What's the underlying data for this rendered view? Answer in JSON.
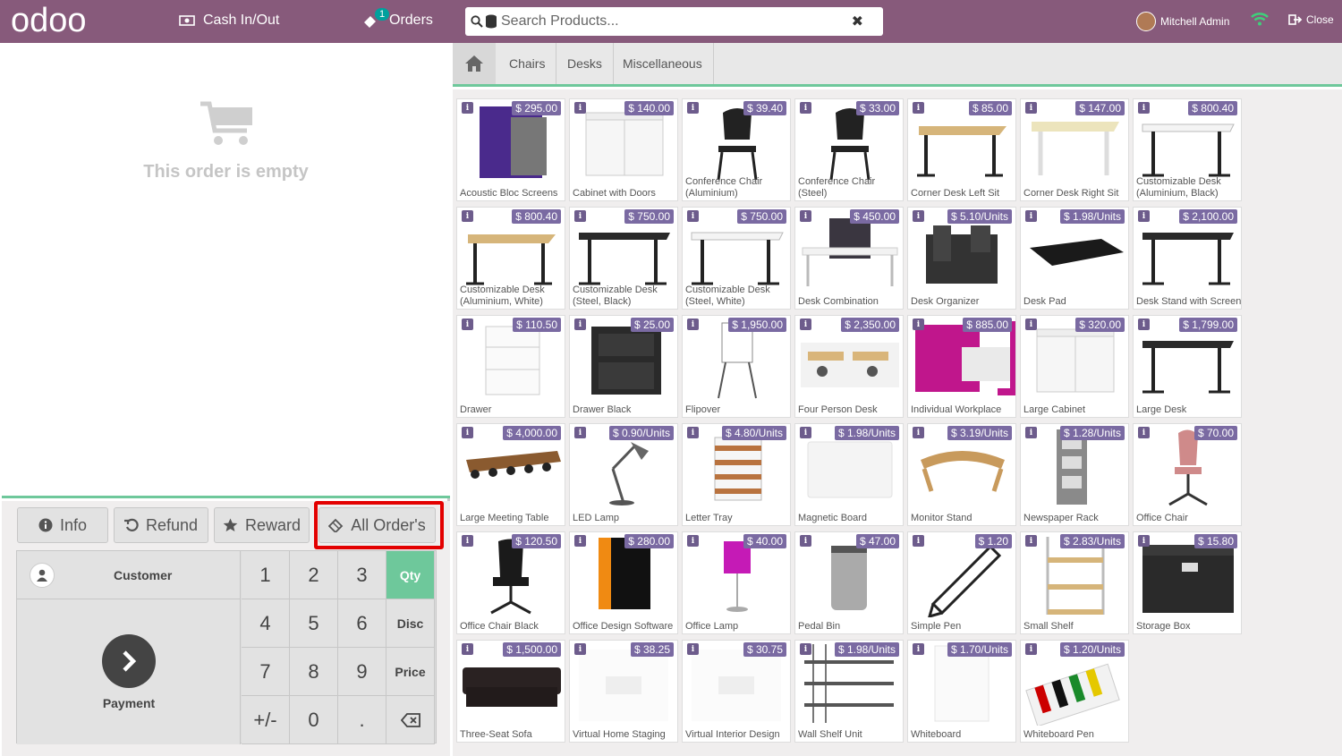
{
  "header": {
    "logo_text": "odoo",
    "cash_label": "Cash In/Out",
    "orders_label": "Orders",
    "orders_count": "1",
    "search_placeholder": "Search Products...",
    "user_name": "Mitchell Admin",
    "close_label": "Close"
  },
  "order": {
    "empty_text": "This order is empty"
  },
  "controls": {
    "info_label": "Info",
    "refund_label": "Refund",
    "reward_label": "Reward",
    "all_orders_label": "All Order's",
    "customer_label": "Customer",
    "payment_label": "Payment",
    "keys": [
      "1",
      "2",
      "3",
      "4",
      "5",
      "6",
      "7",
      "8",
      "9",
      "+/-",
      "0",
      "."
    ],
    "modes": [
      "Qty",
      "Disc",
      "Price"
    ],
    "active_mode": "Qty"
  },
  "categories": [
    "Chairs",
    "Desks",
    "Miscellaneous"
  ],
  "products": [
    {
      "name": "Acoustic Bloc Screens",
      "price": "$ 295.00",
      "icon": "screen"
    },
    {
      "name": "Cabinet with Doors",
      "price": "$ 140.00",
      "icon": "cabinet"
    },
    {
      "name": "Conference Chair (Aluminium)",
      "price": "$ 39.40",
      "icon": "chair"
    },
    {
      "name": "Conference Chair (Steel)",
      "price": "$ 33.00",
      "icon": "chair"
    },
    {
      "name": "Corner Desk Left Sit",
      "price": "$ 85.00",
      "icon": "desk-wood"
    },
    {
      "name": "Corner Desk Right Sit",
      "price": "$ 147.00",
      "icon": "desk-light"
    },
    {
      "name": "Customizable Desk (Aluminium, Black)",
      "price": "$ 800.40",
      "icon": "desk-white"
    },
    {
      "name": "Customizable Desk (Aluminium, White)",
      "price": "$ 800.40",
      "icon": "desk-wood"
    },
    {
      "name": "Customizable Desk (Steel, Black)",
      "price": "$ 750.00",
      "icon": "desk-black"
    },
    {
      "name": "Customizable Desk (Steel, White)",
      "price": "$ 750.00",
      "icon": "desk-white"
    },
    {
      "name": "Desk Combination",
      "price": "$ 450.00",
      "icon": "desk-combo"
    },
    {
      "name": "Desk Organizer",
      "price": "$ 5.10/Units",
      "icon": "organizer"
    },
    {
      "name": "Desk Pad",
      "price": "$ 1.98/Units",
      "icon": "pad"
    },
    {
      "name": "Desk Stand with Screen",
      "price": "$ 2,100.00",
      "icon": "desk-black"
    },
    {
      "name": "Drawer",
      "price": "$ 110.50",
      "icon": "drawer-white"
    },
    {
      "name": "Drawer Black",
      "price": "$ 25.00",
      "icon": "drawer-black"
    },
    {
      "name": "Flipover",
      "price": "$ 1,950.00",
      "icon": "flipover"
    },
    {
      "name": "Four Person Desk",
      "price": "$ 2,350.00",
      "icon": "office"
    },
    {
      "name": "Individual Workplace",
      "price": "$ 885.00",
      "icon": "pod"
    },
    {
      "name": "Large Cabinet",
      "price": "$ 320.00",
      "icon": "cabinet"
    },
    {
      "name": "Large Desk",
      "price": "$ 1,799.00",
      "icon": "desk-black"
    },
    {
      "name": "Large Meeting Table",
      "price": "$ 4,000.00",
      "icon": "meeting"
    },
    {
      "name": "LED Lamp",
      "price": "$ 0.90/Units",
      "icon": "lamp"
    },
    {
      "name": "Letter Tray",
      "price": "$ 4.80/Units",
      "icon": "tray"
    },
    {
      "name": "Magnetic Board",
      "price": "$ 1.98/Units",
      "icon": "board"
    },
    {
      "name": "Monitor Stand",
      "price": "$ 3.19/Units",
      "icon": "stand"
    },
    {
      "name": "Newspaper Rack",
      "price": "$ 1.28/Units",
      "icon": "rack"
    },
    {
      "name": "Office Chair",
      "price": "$ 70.00",
      "icon": "pink-chair"
    },
    {
      "name": "Office Chair Black",
      "price": "$ 120.50",
      "icon": "black-chair"
    },
    {
      "name": "Office Design Software",
      "price": "$ 280.00",
      "icon": "software"
    },
    {
      "name": "Office Lamp",
      "price": "$ 40.00",
      "icon": "pink-lamp"
    },
    {
      "name": "Pedal Bin",
      "price": "$ 47.00",
      "icon": "bin"
    },
    {
      "name": "Simple Pen",
      "price": "$ 1.20",
      "icon": "pen"
    },
    {
      "name": "Small Shelf",
      "price": "$ 2.83/Units",
      "icon": "shelf"
    },
    {
      "name": "Storage Box",
      "price": "$ 15.80",
      "icon": "box"
    },
    {
      "name": "Three-Seat Sofa",
      "price": "$ 1,500.00",
      "icon": "sofa"
    },
    {
      "name": "Virtual Home Staging",
      "price": "$ 38.25",
      "icon": "faded"
    },
    {
      "name": "Virtual Interior Design",
      "price": "$ 30.75",
      "icon": "faded"
    },
    {
      "name": "Wall Shelf Unit",
      "price": "$ 1.98/Units",
      "icon": "wallshelf"
    },
    {
      "name": "Whiteboard",
      "price": "$ 1.70/Units",
      "icon": "whiteboard"
    },
    {
      "name": "Whiteboard Pen",
      "price": "$ 1.20/Units",
      "icon": "markers"
    }
  ]
}
